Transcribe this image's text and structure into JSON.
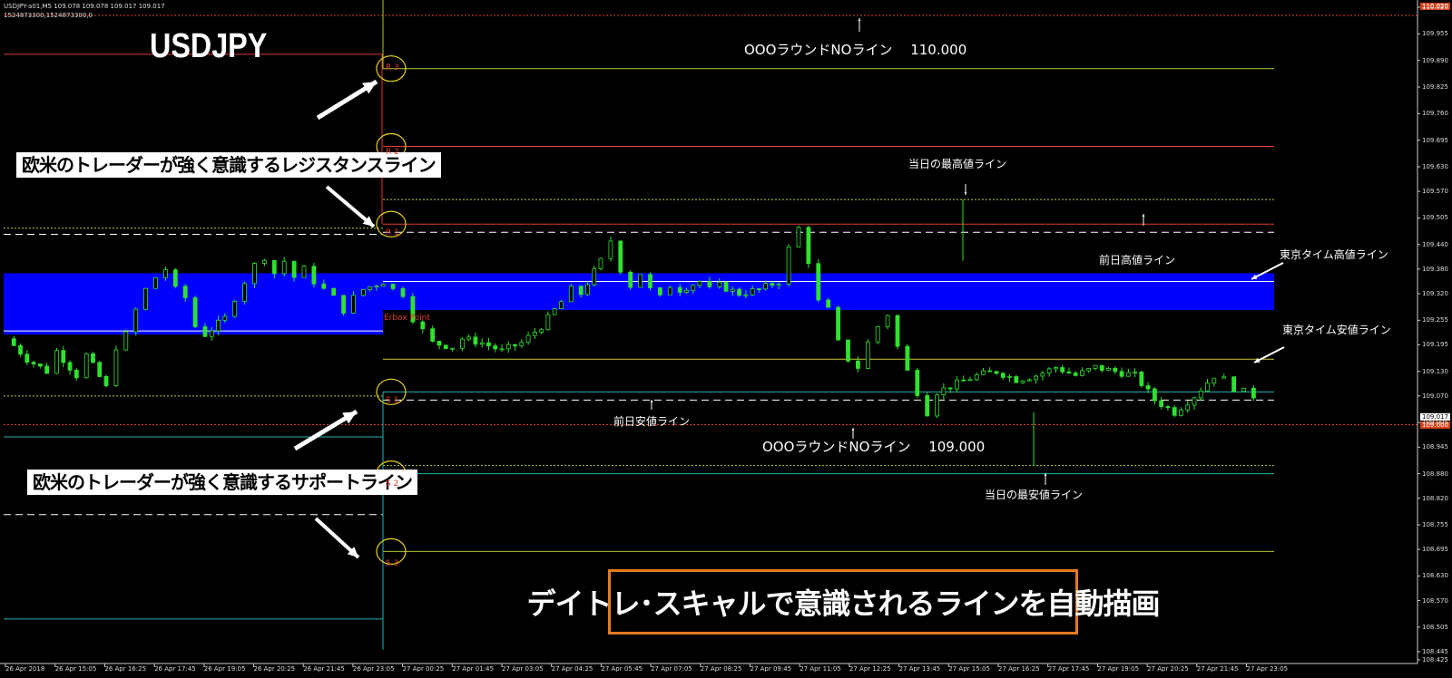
{
  "header": {
    "line1": "USDJPY-a01,M5  109.078 109.078 109.017 109.017",
    "line2": "1524873300,1524873300,0"
  },
  "symbol_title": "USDJPY",
  "annotations": {
    "round_110": "OOOラウンドNOライン　 110.000",
    "round_109": "OOOラウンドNOライン　 109.000",
    "today_high": "当日の最高値ライン",
    "today_low": "当日の最安値ライン",
    "prev_high": "前日高値ライン",
    "prev_low": "前日安値ライン",
    "tokyo_high": "東京タイム高値ライン",
    "tokyo_low": "東京タイム安値ライン",
    "erbox": "Erbox Point"
  },
  "callouts": {
    "resistance": "欧米のトレーダーが強く意識するレジスタンスライン",
    "support": "欧米のトレーダーが強く意識するサポートライン"
  },
  "banner": "デイトレ･スキャルで意識されるラインを自動描画",
  "pivots": [
    "R 3",
    "R 2",
    "R 1",
    "S 1",
    "S 2",
    "S 3"
  ],
  "price_tags": {
    "current": "109.017",
    "round": "109.000",
    "top": "110.020"
  },
  "colors": {
    "background": "#000000",
    "candle": "#2ee22e",
    "tokyo_box": "#0000ff",
    "resistance_line": "#e23a2a",
    "pivot_line": "#aacc33",
    "support_line": "#24b3b3",
    "banner_border": "#e57a1e"
  },
  "chart_data": {
    "type": "candlestick",
    "symbol": "USDJPY",
    "timeframe": "M5",
    "ylim": [
      108.425,
      110.02
    ],
    "y_ticks": [
      "110.020",
      "109.955",
      "109.890",
      "109.825",
      "109.760",
      "109.695",
      "109.630",
      "109.570",
      "109.505",
      "109.440",
      "109.380",
      "109.320",
      "109.255",
      "109.195",
      "109.130",
      "109.070",
      "109.005",
      "108.945",
      "108.880",
      "108.820",
      "108.755",
      "108.695",
      "108.630",
      "108.570",
      "108.505",
      "108.445",
      "108.425"
    ],
    "x_ticks": [
      "26 Apr 2018",
      "26 Apr 15:05",
      "26 Apr 16:25",
      "26 Apr 17:45",
      "26 Apr 19:05",
      "26 Apr 20:25",
      "26 Apr 21:45",
      "26 Apr 23:05",
      "27 Apr 00:25",
      "27 Apr 01:45",
      "27 Apr 03:05",
      "27 Apr 04:25",
      "27 Apr 05:45",
      "27 Apr 07:05",
      "27 Apr 08:25",
      "27 Apr 09:45",
      "27 Apr 11:05",
      "27 Apr 12:25",
      "27 Apr 13:45",
      "27 Apr 15:05",
      "27 Apr 16:25",
      "27 Apr 17:45",
      "27 Apr 19:05",
      "27 Apr 20:25",
      "27 Apr 21:45",
      "27 Apr 23:05"
    ],
    "levels": {
      "round_110": 110.0,
      "prev_R3": 109.905,
      "R3": 109.87,
      "R2": 109.68,
      "today_high": 109.55,
      "R1": 109.49,
      "prev_high": 109.47,
      "tokyo_high": 109.37,
      "tokyo_low": 109.28,
      "prev_tokyo_high": 109.37,
      "prev_tokyo_low": 109.22,
      "tokyo_mid": 109.35,
      "yellow_mid": 109.16,
      "S1": 109.08,
      "prev_low": 109.06,
      "round_109": 109.0,
      "today_low": 108.9,
      "S2": 108.88,
      "S3": 108.69
    },
    "path": [
      [
        0,
        109.21
      ],
      [
        2,
        109.16
      ],
      [
        4,
        109.13
      ],
      [
        5,
        109.18
      ],
      [
        7,
        109.12
      ],
      [
        8,
        109.17
      ],
      [
        10,
        109.09
      ],
      [
        11,
        109.19
      ],
      [
        12,
        109.22
      ],
      [
        13,
        109.28
      ],
      [
        14,
        109.33
      ],
      [
        15,
        109.36
      ],
      [
        16,
        109.38
      ],
      [
        17,
        109.33
      ],
      [
        18,
        109.31
      ],
      [
        19,
        109.24
      ],
      [
        20,
        109.22
      ],
      [
        22,
        109.26
      ],
      [
        23,
        109.31
      ],
      [
        24,
        109.35
      ],
      [
        25,
        109.39
      ],
      [
        26,
        109.41
      ],
      [
        27,
        109.37
      ],
      [
        28,
        109.4
      ],
      [
        29,
        109.36
      ],
      [
        30,
        109.38
      ],
      [
        31,
        109.35
      ],
      [
        32,
        109.33
      ],
      [
        33,
        109.31
      ],
      [
        34,
        109.28
      ],
      [
        35,
        109.31
      ],
      [
        36,
        109.33
      ],
      [
        38,
        109.35
      ],
      [
        39,
        109.33
      ],
      [
        40,
        109.32
      ],
      [
        41,
        109.26
      ],
      [
        42,
        109.23
      ],
      [
        43,
        109.2
      ],
      [
        45,
        109.19
      ],
      [
        46,
        109.21
      ],
      [
        48,
        109.2
      ],
      [
        50,
        109.18
      ],
      [
        52,
        109.2
      ],
      [
        54,
        109.24
      ],
      [
        56,
        109.3
      ],
      [
        57,
        109.33
      ],
      [
        58,
        109.32
      ],
      [
        60,
        109.4
      ],
      [
        61,
        109.45
      ],
      [
        62,
        109.38
      ],
      [
        63,
        109.34
      ],
      [
        64,
        109.37
      ],
      [
        65,
        109.33
      ],
      [
        66,
        109.31
      ],
      [
        67,
        109.34
      ],
      [
        68,
        109.33
      ],
      [
        70,
        109.35
      ],
      [
        71,
        109.33
      ],
      [
        72,
        109.34
      ],
      [
        74,
        109.32
      ],
      [
        76,
        109.33
      ],
      [
        78,
        109.35
      ],
      [
        79,
        109.43
      ],
      [
        80,
        109.48
      ],
      [
        81,
        109.4
      ],
      [
        82,
        109.3
      ],
      [
        83,
        109.28
      ],
      [
        84,
        109.2
      ],
      [
        85,
        109.16
      ],
      [
        86,
        109.14
      ],
      [
        87,
        109.2
      ],
      [
        88,
        109.24
      ],
      [
        89,
        109.27
      ],
      [
        90,
        109.19
      ],
      [
        91,
        109.13
      ],
      [
        92,
        109.08
      ],
      [
        93,
        109.03
      ],
      [
        94,
        109.08
      ],
      [
        96,
        109.1
      ],
      [
        98,
        109.12
      ],
      [
        100,
        109.13
      ],
      [
        102,
        109.11
      ],
      [
        104,
        109.12
      ],
      [
        106,
        109.14
      ],
      [
        108,
        109.12
      ],
      [
        110,
        109.14
      ],
      [
        112,
        109.13
      ],
      [
        114,
        109.12
      ],
      [
        116,
        109.06
      ],
      [
        118,
        109.03
      ],
      [
        120,
        109.07
      ],
      [
        122,
        109.12
      ],
      [
        123,
        109.11
      ],
      [
        124,
        109.09
      ],
      [
        125,
        109.08
      ],
      [
        126,
        109.07
      ]
    ]
  }
}
